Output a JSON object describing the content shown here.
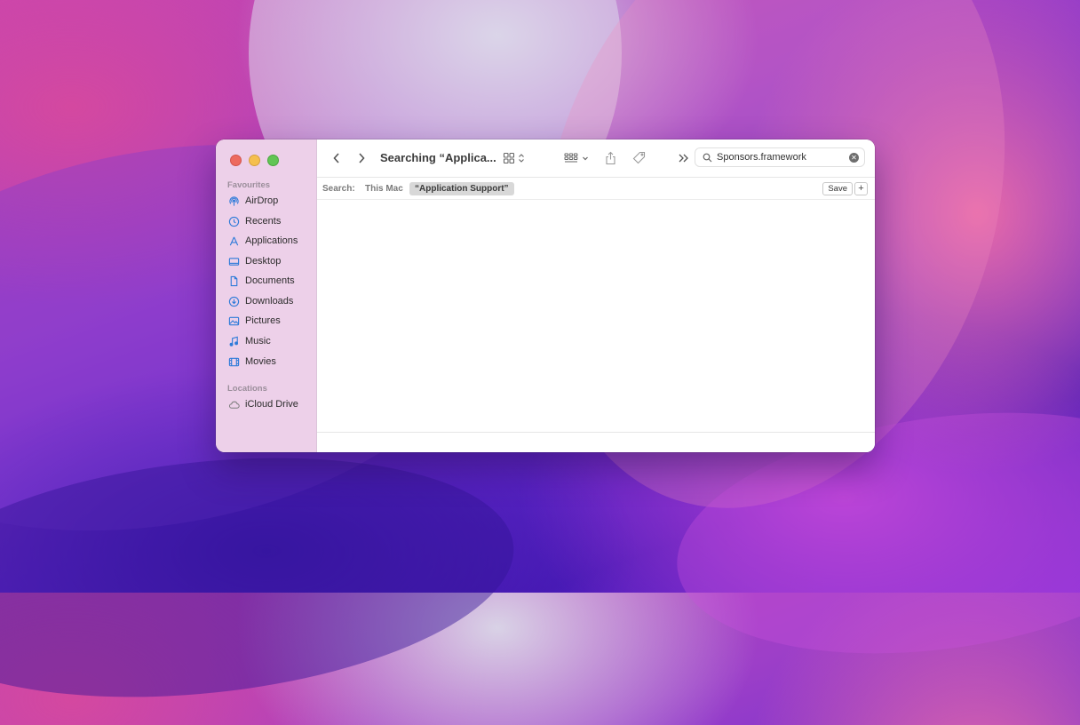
{
  "window": {
    "title": "Searching “Applica...",
    "search_field": {
      "value": "Sponsors.framework"
    }
  },
  "sidebar": {
    "favourites_title": "Favourites",
    "favourites": [
      {
        "label": "AirDrop",
        "icon": "airdrop-icon"
      },
      {
        "label": "Recents",
        "icon": "clock-icon"
      },
      {
        "label": "Applications",
        "icon": "applications-icon"
      },
      {
        "label": "Desktop",
        "icon": "desktop-icon"
      },
      {
        "label": "Documents",
        "icon": "document-icon"
      },
      {
        "label": "Downloads",
        "icon": "download-icon"
      },
      {
        "label": "Pictures",
        "icon": "photo-icon"
      },
      {
        "label": "Music",
        "icon": "music-note-icon"
      },
      {
        "label": "Movies",
        "icon": "film-icon"
      }
    ],
    "locations_title": "Locations",
    "locations": [
      {
        "label": "iCloud Drive",
        "icon": "cloud-icon"
      }
    ]
  },
  "scope_bar": {
    "label": "Search:",
    "options": [
      "This Mac",
      "“Application Support”"
    ],
    "selected": "“Application Support”",
    "save_label": "Save",
    "add_label": "+"
  },
  "colors": {
    "accent": "#1a73e8",
    "close": "#ed6a5e",
    "minimize": "#f5bf4f",
    "zoom": "#61c554"
  }
}
